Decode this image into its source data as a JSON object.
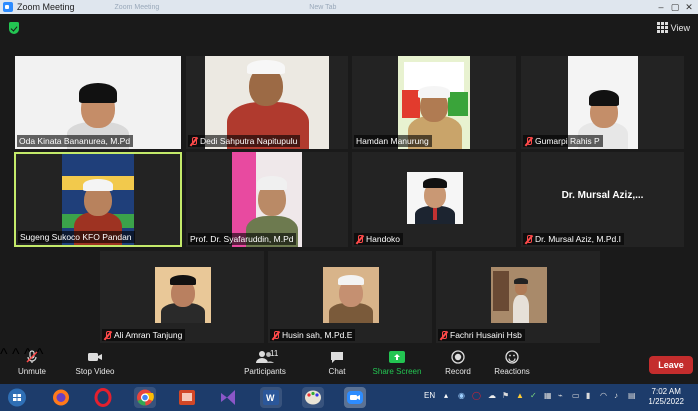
{
  "window": {
    "title": "Zoom Meeting",
    "ghost_tab_1": "Zoom Meeting",
    "ghost_tab_2": "New Tab"
  },
  "topbar": {
    "view_label": "View"
  },
  "participants": [
    {
      "name": "Oda Kinata Bananurea, M.Pd",
      "muted": false
    },
    {
      "name": "Dedi Sahputra Napitupulu",
      "muted": true
    },
    {
      "name": "Hamdan Manurung",
      "muted": false
    },
    {
      "name": "Gumarpi Rahis P",
      "muted": true
    },
    {
      "name": "Sugeng Sukoco KFO Pandan",
      "muted": false,
      "active": true
    },
    {
      "name": "Prof. Dr. Syafaruddin, M.Pd",
      "muted": false
    },
    {
      "name": "Handoko",
      "muted": true
    },
    {
      "name": "Dr. Mursal Aziz, M.Pd.I",
      "muted": true,
      "video_off_name": "Dr. Mursal Aziz,..."
    },
    {
      "name": "Ali Amran Tanjung",
      "muted": true
    },
    {
      "name": "Husin sah, M.Pd.E",
      "muted": true
    },
    {
      "name": "Fachri Husaini Hsb",
      "muted": true
    }
  ],
  "toolbar": {
    "unmute": "Unmute",
    "stop_video": "Stop Video",
    "participants": "Participants",
    "participants_count": "11",
    "chat": "Chat",
    "share_screen": "Share Screen",
    "record": "Record",
    "reactions": "Reactions",
    "leave": "Leave"
  },
  "taskbar": {
    "language": "EN",
    "time": "7:02 AM",
    "date": "1/25/2022"
  },
  "colors": {
    "active_speaker": "#c4ea6a",
    "leave": "#c42d2d",
    "share": "#23c552",
    "mute": "#ff4a4a"
  }
}
